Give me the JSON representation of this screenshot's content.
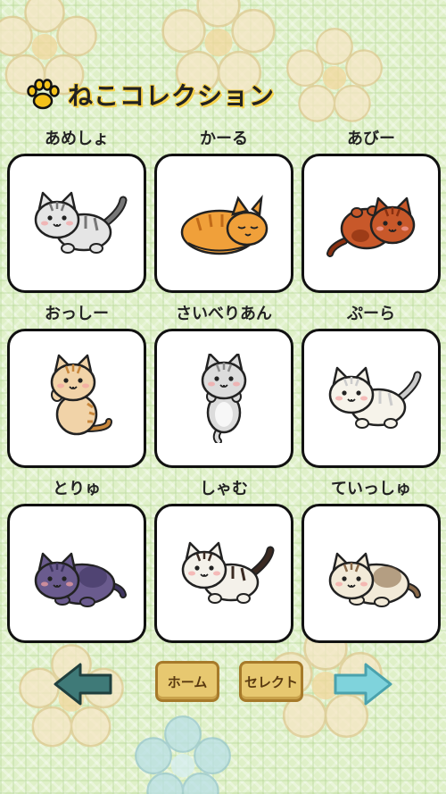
{
  "header": {
    "title": "ねこコレクション",
    "icon": "paw-icon"
  },
  "cats": [
    {
      "name": "あめしょ",
      "fur": "#e5e5e5",
      "stripe": "#777",
      "pose": "walk"
    },
    {
      "name": "かーる",
      "fur": "#f0a03a",
      "stripe": "#c06a18",
      "pose": "sleep"
    },
    {
      "name": "あびー",
      "fur": "#c8582a",
      "stripe": "#8a3010",
      "pose": "roll"
    },
    {
      "name": "おっしー",
      "fur": "#f1d3a8",
      "stripe": "#c8873c",
      "pose": "sit"
    },
    {
      "name": "さいべりあん",
      "fur": "#dcdcdc",
      "stripe": "#8a8a8a",
      "pose": "hang"
    },
    {
      "name": "ぷーら",
      "fur": "#f6f3ea",
      "stripe": "#ccc",
      "pose": "walk"
    },
    {
      "name": "とりゅ",
      "fur": "#6a5b8e",
      "stripe": "#3f3560",
      "pose": "lie"
    },
    {
      "name": "しゃむ",
      "fur": "#f4f1ea",
      "stripe": "#3a2a22",
      "pose": "walk"
    },
    {
      "name": "ていっしゅ",
      "fur": "#f2ead8",
      "stripe": "#8a6a4a",
      "pose": "lie"
    }
  ],
  "nav": {
    "back_icon": "left-arrow-icon",
    "home_label": "ホーム",
    "select_label": "セレクト",
    "forward_icon": "right-arrow-icon",
    "back_color": "#3f7a78",
    "forward_color": "#7fd3dc"
  }
}
